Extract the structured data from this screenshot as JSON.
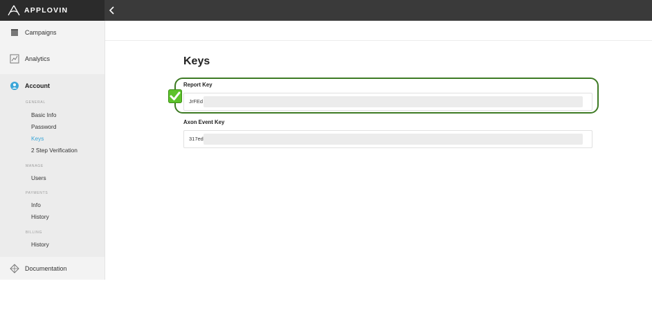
{
  "app": {
    "brand": "APPLOVIN"
  },
  "sidebar": {
    "campaigns": "Campaigns",
    "analytics": "Analytics",
    "account": "Account",
    "documentation": "Documentation",
    "sections": {
      "general": "GENERAL",
      "manage": "MANAGE",
      "payments": "PAYMENTS",
      "billing": "BILLING"
    },
    "items": {
      "basic_info": "Basic Info",
      "password": "Password",
      "keys": "Keys",
      "two_step": "2 Step Verification",
      "users": "Users",
      "payments_info": "Info",
      "payments_history": "History",
      "billing_history": "History"
    }
  },
  "main": {
    "title": "Keys",
    "report_key": {
      "label": "Report Key",
      "value": "JrFEd"
    },
    "axon_key": {
      "label": "Axon Event Key",
      "value": "317ed"
    }
  },
  "colors": {
    "accent": "#3aa6d8",
    "highlight_border": "#3d7a23",
    "check": "#5cc22a"
  }
}
